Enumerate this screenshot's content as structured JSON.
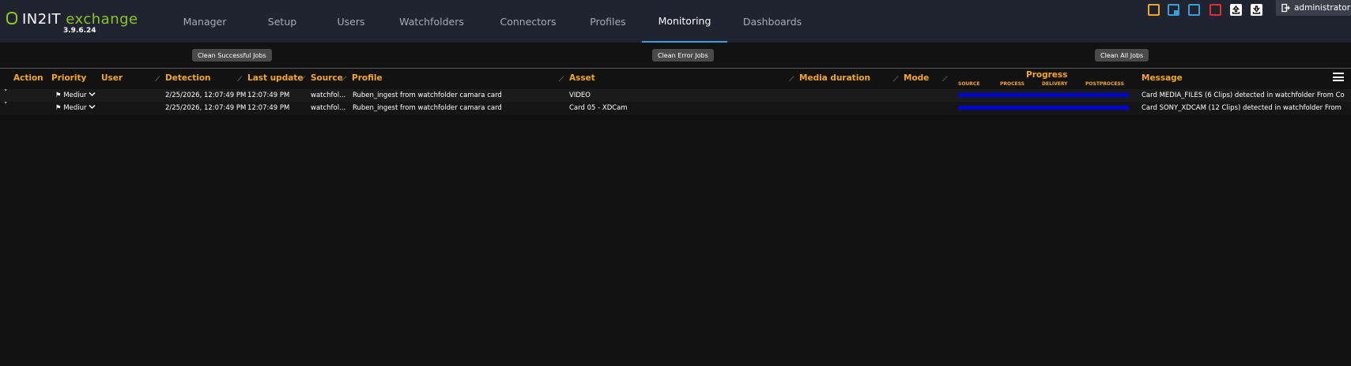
{
  "app": {
    "logo_text": "IN2IT",
    "logo_accent": "exchange",
    "version": "3.9.6.24",
    "accent_color": "#8fc31f"
  },
  "nav": {
    "items": [
      {
        "label": "Manager",
        "active": false
      },
      {
        "label": "Setup",
        "active": false
      },
      {
        "label": "Users",
        "active": false
      },
      {
        "label": "Watchfolders",
        "active": false
      },
      {
        "label": "Connectors",
        "active": false
      },
      {
        "label": "Profiles",
        "active": false
      },
      {
        "label": "Monitoring",
        "active": true
      },
      {
        "label": "Dashboards",
        "active": false
      }
    ]
  },
  "toolbar": {
    "icons": [
      {
        "name": "orange-square-icon",
        "color": "#f5a623"
      },
      {
        "name": "cyan-square-corner-icon",
        "color": "#3aa0d8"
      },
      {
        "name": "blue-square-icon",
        "color": "#3aa0d8"
      },
      {
        "name": "red-square-icon",
        "color": "#e03030"
      },
      {
        "name": "upload-icon",
        "color": "#ffffff"
      },
      {
        "name": "download-icon",
        "color": "#ffffff"
      }
    ],
    "user": "administrator"
  },
  "actions": {
    "clean_successful": "Clean Successful Jobs",
    "clean_error": "Clean Error Jobs",
    "clean_all": "Clean All Jobs"
  },
  "table": {
    "headers": {
      "action": "Action",
      "priority": "Priority",
      "user": "User",
      "detection": "Detection",
      "last_update": "Last update",
      "source": "Source",
      "profile": "Profile",
      "asset": "Asset",
      "media_duration": "Media duration",
      "mode": "Mode",
      "progress": "Progress",
      "message": "Message"
    },
    "progress_stages": [
      "SOURCE",
      "PROCESS",
      "DELIVERY",
      "POSTPROCESS"
    ],
    "rows": [
      {
        "expand": "˅",
        "priority": "Mediur",
        "user": "",
        "detection": "2/25/2026, 12:07:49 PM",
        "last_update": "12:07:49 PM",
        "source": "watchfol...",
        "profile": "Ruben_ingest from watchfolder camara card",
        "asset": "VIDEO",
        "media_duration": "",
        "mode": "",
        "progress": 1.0,
        "message": "Card MEDIA_FILES (6 Clips) detected in watchfolder From Co"
      },
      {
        "expand": "˅",
        "priority": "Mediur",
        "user": "",
        "detection": "2/25/2026, 12:07:49 PM",
        "last_update": "12:07:49 PM",
        "source": "watchfol...",
        "profile": "Ruben_ingest from watchfolder camara card",
        "asset": "Card 05 - XDCam",
        "media_duration": "",
        "mode": "",
        "progress": 1.0,
        "message": "Card SONY_XDCAM (12 Clips) detected in watchfolder From"
      }
    ]
  }
}
